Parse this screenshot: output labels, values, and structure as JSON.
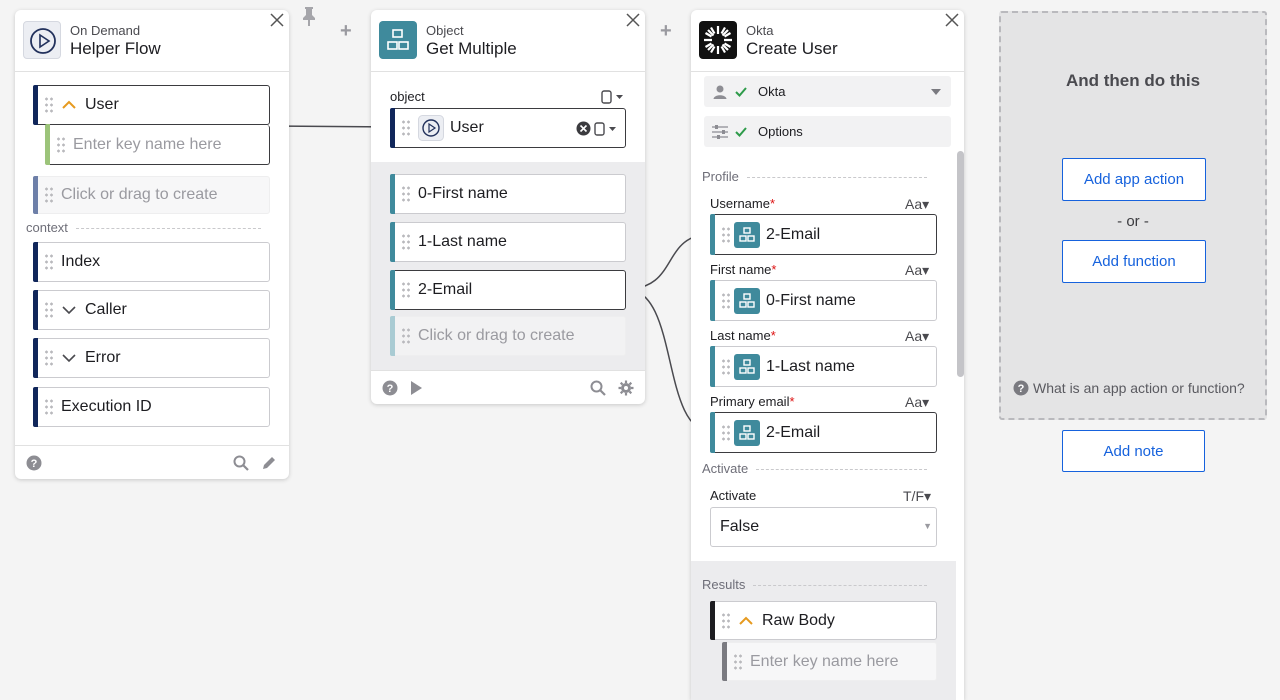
{
  "helper_card": {
    "subtitle": "On Demand",
    "title": "Helper Flow",
    "user_label": "User",
    "key_placeholder": "Enter key name here",
    "create_placeholder": "Click or drag to create",
    "context_label": "context",
    "fields": [
      "Index",
      "Caller",
      "Error",
      "Execution ID"
    ]
  },
  "object_card": {
    "subtitle": "Object",
    "title": "Get Multiple",
    "object_label": "object",
    "object_value": "User",
    "outputs": [
      "0-First name",
      "1-Last name",
      "2-Email"
    ],
    "create_placeholder": "Click or drag to create"
  },
  "okta_card": {
    "subtitle": "Okta",
    "title": "Create User",
    "connection": "Okta",
    "options_label": "Options",
    "profile_label": "Profile",
    "fields": [
      {
        "label": "Username",
        "type": "Aa",
        "value": "2-Email"
      },
      {
        "label": "First name",
        "type": "Aa",
        "value": "0-First name"
      },
      {
        "label": "Last name",
        "type": "Aa",
        "value": "1-Last name"
      },
      {
        "label": "Primary email",
        "type": "Aa",
        "value": "2-Email"
      }
    ],
    "activate_section": "Activate",
    "activate_label": "Activate",
    "activate_type": "T/F",
    "activate_value": "False",
    "results_label": "Results",
    "raw_body": "Raw Body",
    "key_placeholder": "Enter key name here"
  },
  "next_panel": {
    "heading": "And then do this",
    "add_app_action": "Add app action",
    "or_text": "- or -",
    "add_function": "Add function",
    "help_text": "What is an app action or function?",
    "add_note": "Add note"
  },
  "colors": {
    "accent_blue": "#1662dd",
    "navy_bar": "#10265a",
    "teal_bar": "#3f8a9c",
    "green_bar": "#9cc47a",
    "check_green": "#2e9b4a"
  }
}
